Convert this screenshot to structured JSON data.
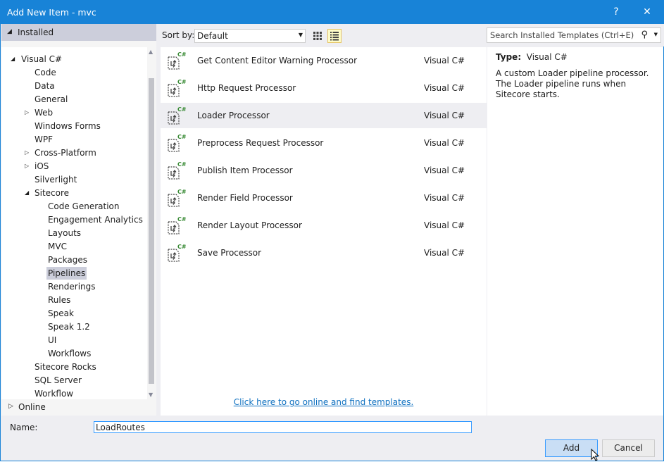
{
  "window": {
    "title": "Add New Item - mvc",
    "help_label": "?",
    "close_label": "✕",
    "accent_color": "#1883d7"
  },
  "left": {
    "installed_label": "Installed",
    "online_label": "Online",
    "tree": [
      {
        "label": "Visual C#",
        "expander": "◢",
        "level": 0
      },
      {
        "label": "Code",
        "expander": "",
        "level": 1
      },
      {
        "label": "Data",
        "expander": "",
        "level": 1
      },
      {
        "label": "General",
        "expander": "",
        "level": 1
      },
      {
        "label": "Web",
        "expander": "▷",
        "level": 1
      },
      {
        "label": "Windows Forms",
        "expander": "",
        "level": 1
      },
      {
        "label": "WPF",
        "expander": "",
        "level": 1
      },
      {
        "label": "Cross-Platform",
        "expander": "▷",
        "level": 1
      },
      {
        "label": "iOS",
        "expander": "▷",
        "level": 1
      },
      {
        "label": "Silverlight",
        "expander": "",
        "level": 1
      },
      {
        "label": "Sitecore",
        "expander": "◢",
        "level": 1
      },
      {
        "label": "Code Generation",
        "expander": "",
        "level": 2
      },
      {
        "label": "Engagement Analytics",
        "expander": "",
        "level": 2
      },
      {
        "label": "Layouts",
        "expander": "",
        "level": 2
      },
      {
        "label": "MVC",
        "expander": "",
        "level": 2
      },
      {
        "label": "Packages",
        "expander": "",
        "level": 2
      },
      {
        "label": "Pipelines",
        "expander": "",
        "level": 2,
        "selected": true
      },
      {
        "label": "Renderings",
        "expander": "",
        "level": 2
      },
      {
        "label": "Rules",
        "expander": "",
        "level": 2
      },
      {
        "label": "Speak",
        "expander": "",
        "level": 2
      },
      {
        "label": "Speak 1.2",
        "expander": "",
        "level": 2
      },
      {
        "label": "UI",
        "expander": "",
        "level": 2
      },
      {
        "label": "Workflows",
        "expander": "",
        "level": 2
      },
      {
        "label": "Sitecore Rocks",
        "expander": "",
        "level": 1
      },
      {
        "label": "SQL Server",
        "expander": "",
        "level": 1
      },
      {
        "label": "Workflow",
        "expander": "",
        "level": 1
      }
    ]
  },
  "toolbar": {
    "sort_label": "Sort by:",
    "sort_value": "Default",
    "search_placeholder": "Search Installed Templates (Ctrl+E)",
    "active_view": "list"
  },
  "templates": [
    {
      "name": "Get Content Editor Warning Processor",
      "lang": "Visual C#"
    },
    {
      "name": "Http Request Processor",
      "lang": "Visual C#"
    },
    {
      "name": "Loader Processor",
      "lang": "Visual C#",
      "selected": true
    },
    {
      "name": "Preprocess Request Processor",
      "lang": "Visual C#"
    },
    {
      "name": "Publish Item Processor",
      "lang": "Visual C#"
    },
    {
      "name": "Render Field Processor",
      "lang": "Visual C#"
    },
    {
      "name": "Render Layout Processor",
      "lang": "Visual C#"
    },
    {
      "name": "Save Processor",
      "lang": "Visual C#"
    }
  ],
  "online_link": "Click here to go online and find templates.",
  "details": {
    "type_label": "Type:",
    "type_value": "Visual C#",
    "description": "A custom Loader pipeline processor. The Loader pipeline runs when Sitecore starts."
  },
  "bottom": {
    "name_label": "Name:",
    "name_value": "LoadRoutes",
    "add_label": "Add",
    "cancel_label": "Cancel"
  }
}
